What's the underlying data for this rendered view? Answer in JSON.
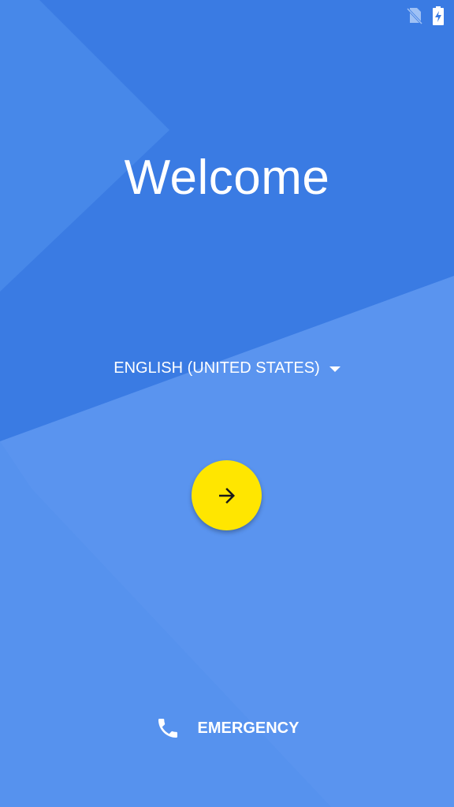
{
  "status_bar": {
    "icons": [
      "no-sim-icon",
      "battery-charging-icon"
    ]
  },
  "welcome": {
    "title": "Welcome"
  },
  "language": {
    "selected": "ENGLISH (UNITED STATES)",
    "icon": "dropdown-caret-icon"
  },
  "next_button": {
    "icon": "arrow-right-icon",
    "color": "#ffe600"
  },
  "emergency": {
    "label": "EMERGENCY",
    "icon": "phone-icon"
  },
  "colors": {
    "background": "#3a7be3",
    "accent": "#ffe600",
    "text": "#ffffff"
  }
}
